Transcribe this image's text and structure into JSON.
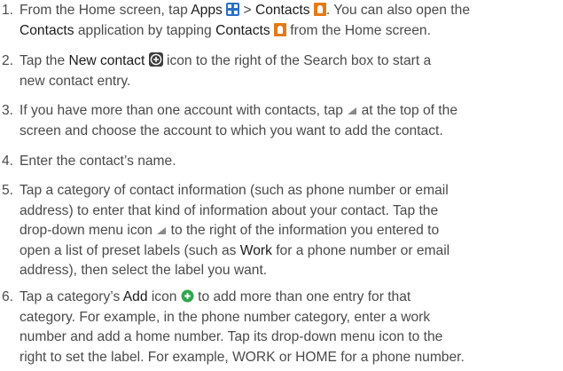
{
  "steps": [
    {
      "num": "1.",
      "t1": "From the Home screen, tap ",
      "apps": "Apps",
      "t2": " > ",
      "contacts": "Contacts",
      "t3": ". You can also open the",
      "contacts2": "Contacts",
      "t4": " application by tapping ",
      "contacts3": "Contacts",
      "t5": " from the Home screen."
    },
    {
      "num": "2.",
      "t1": "Tap the ",
      "new_contact": "New contact",
      "t2": " icon to the right of the Search box to start a",
      "t3": "new contact entry."
    },
    {
      "num": "3.",
      "t1": "If you have more than one account with contacts, tap ",
      "t2": " at the top of the",
      "t3": "screen and choose the account to which you want to add the contact."
    },
    {
      "num": "4.",
      "t1": "Enter the contact’s name."
    },
    {
      "num": "5.",
      "l1": "Tap a category of contact information (such as phone number or email",
      "l2": "address) to enter that kind of information about your contact. Tap the",
      "l3a": "drop-down menu icon ",
      "l3b": " to the right of the information you entered to",
      "l4a": "open a list of preset labels (such as ",
      "work": "Work",
      "l4b": " for a phone number or email",
      "l5": "address), then select the label you want."
    },
    {
      "num": "6.",
      "l1a": "Tap a category’s ",
      "add": "Add",
      "l1b": " icon ",
      "l1c": " to add more than one entry for that",
      "l2": "category. For example, in the phone number category, enter a work",
      "l3": "number and add a home number. Tap its drop-down menu icon to the",
      "l4": "right to set the label. For example, WORK or HOME for a phone number."
    }
  ],
  "icons": {
    "apps": "apps-grid-icon",
    "contacts": "contacts-icon",
    "new_contact": "new-contact-plus-icon",
    "dropdown": "dropdown-triangle-icon",
    "add": "green-add-icon"
  },
  "colors": {
    "text": "#4a4a4a",
    "emphasis": "#1a1a1a",
    "apps_blue": "#2a6fc6",
    "contacts_orange": "#e37a17",
    "add_green": "#2fa84f"
  }
}
